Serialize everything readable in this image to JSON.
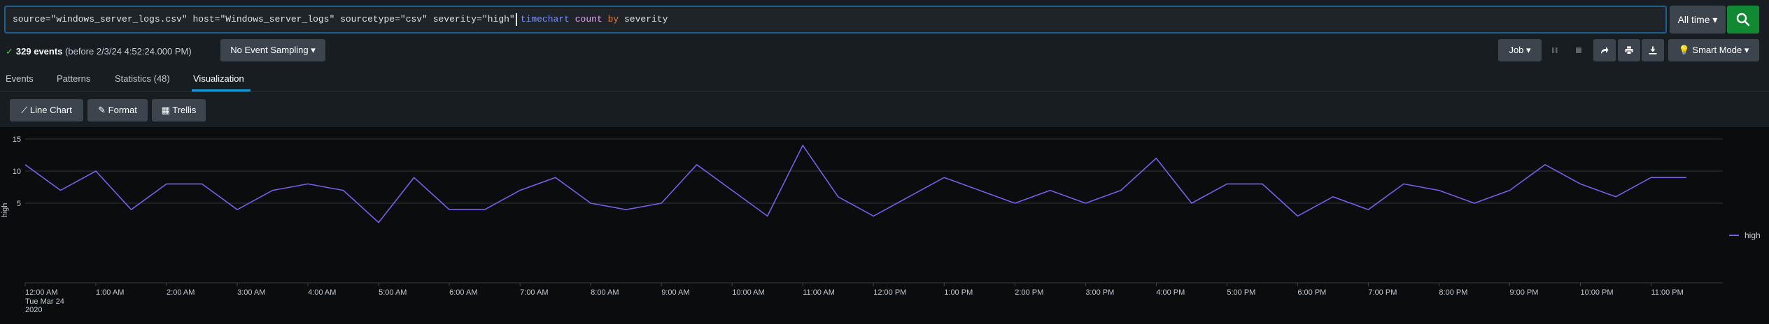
{
  "search": {
    "query_plain": "source=\"windows_server_logs.csv\" host=\"Windows_server_logs\" sourcetype=\"csv\" severity=\"high\"",
    "cmd_timechart": "timechart",
    "fn_count": "count",
    "kw_by": "by",
    "field_severity": "severity",
    "time_range": "All time",
    "submit_icon": "search-icon"
  },
  "status": {
    "events_count": "329 events",
    "events_suffix": "(before 2/3/24 4:52:24.000 PM)",
    "sampling": "No Event Sampling",
    "job": "Job",
    "mode": "Smart Mode",
    "icons": [
      "pause-icon",
      "stop-icon",
      "share-icon",
      "print-icon",
      "export-icon",
      "bulb-icon"
    ]
  },
  "tabs": [
    {
      "label": "Events"
    },
    {
      "label": "Patterns"
    },
    {
      "label": "Statistics (48)"
    },
    {
      "label": "Visualization",
      "active": true
    }
  ],
  "viz_toolbar": {
    "line_chart": "Line Chart",
    "format": "Format",
    "trellis": "Trellis"
  },
  "colors": {
    "accent": "#1a9bd7",
    "series": "#7b5ce8",
    "search_green": "#118832",
    "button_gray": "#3c444d"
  },
  "chart_data": {
    "type": "line",
    "ylabel": "high",
    "ylim": [
      0,
      15
    ],
    "yticks": [
      5,
      10,
      15
    ],
    "grid": true,
    "legend_position": "right",
    "x_tick_labels": [
      "12:00 AM",
      "1:00 AM",
      "2:00 AM",
      "3:00 AM",
      "4:00 AM",
      "5:00 AM",
      "6:00 AM",
      "7:00 AM",
      "8:00 AM",
      "9:00 AM",
      "10:00 AM",
      "11:00 AM",
      "12:00 PM",
      "1:00 PM",
      "2:00 PM",
      "3:00 PM",
      "4:00 PM",
      "5:00 PM",
      "6:00 PM",
      "7:00 PM",
      "8:00 PM",
      "9:00 PM",
      "10:00 PM",
      "11:00 PM"
    ],
    "x_first_sub": [
      "Tue Mar 24",
      "2020"
    ],
    "series": [
      {
        "name": "high",
        "x": [
          "00:00",
          "00:30",
          "01:00",
          "01:30",
          "02:00",
          "02:30",
          "03:00",
          "03:30",
          "04:00",
          "04:30",
          "05:00",
          "05:30",
          "06:00",
          "06:30",
          "07:00",
          "07:30",
          "08:00",
          "08:30",
          "09:00",
          "09:30",
          "10:00",
          "10:30",
          "11:00",
          "11:30",
          "12:00",
          "12:30",
          "13:00",
          "13:30",
          "14:00",
          "14:30",
          "15:00",
          "15:30",
          "16:00",
          "16:30",
          "17:00",
          "17:30",
          "18:00",
          "18:30",
          "19:00",
          "19:30",
          "20:00",
          "20:30",
          "21:00",
          "21:30",
          "22:00",
          "22:30",
          "23:00",
          "23:30"
        ],
        "values": [
          11,
          7,
          10,
          4,
          8,
          8,
          4,
          7,
          8,
          7,
          2,
          9,
          4,
          4,
          7,
          9,
          5,
          4,
          5,
          11,
          7,
          3,
          14,
          6,
          3,
          6,
          9,
          7,
          5,
          7,
          5,
          7,
          12,
          5,
          8,
          8,
          3,
          6,
          4,
          8,
          7,
          5,
          7,
          11,
          8,
          6,
          9,
          9
        ]
      }
    ]
  }
}
